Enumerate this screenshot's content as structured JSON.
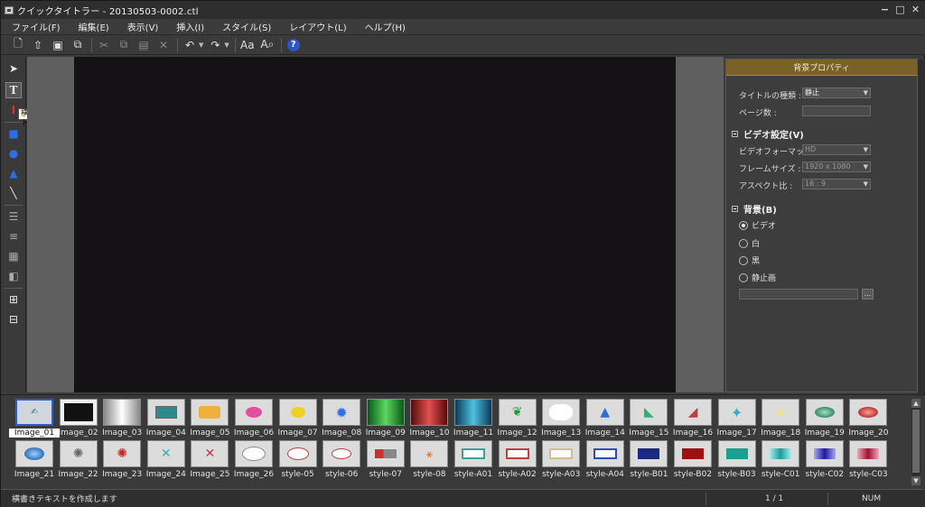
{
  "window": {
    "title": "クイックタイトラー - 20130503-0002.ctl",
    "controls": [
      "−",
      "□",
      "✕"
    ]
  },
  "menu": [
    "ファイル(F)",
    "編集(E)",
    "表示(V)",
    "挿入(I)",
    "スタイル(S)",
    "レイアウト(L)",
    "ヘルプ(H)"
  ],
  "toolbar": {
    "icons": [
      "new-icon",
      "open-icon",
      "save-icon",
      "save-as-icon",
      "cut-icon",
      "copy-icon",
      "paste-icon",
      "delete-icon",
      "undo-icon",
      "redo-icon",
      "text-style-icon",
      "text-search-icon",
      "help-icon"
    ],
    "help_label": "?"
  },
  "tools": [
    "select-arrow-icon",
    "horizontal-text-icon",
    "vertical-text-icon",
    "rectangle-icon",
    "ellipse-icon",
    "triangle-icon",
    "line-icon",
    "align-icon",
    "distribute-icon",
    "layer-icon",
    "arrange-icon",
    "grid-icon",
    "table-icon"
  ],
  "tooltip": "横書きテキスト",
  "properties": {
    "header": "背景プロパティ",
    "title_type_label": "タイトルの種類 :",
    "title_type_value": "静止",
    "page_count_label": "ページ数 :",
    "page_count_value": "",
    "video_section": "ビデオ設定(V)",
    "video_format_label": "ビデオフォーマット :",
    "video_format_value": "HD",
    "frame_size_label": "フレームサイズ :",
    "frame_size_value": "1920 x 1080",
    "aspect_label": "アスペクト比 :",
    "aspect_value": "16 : 9",
    "bg_section": "背景(B)",
    "bg_options": [
      "ビデオ",
      "白",
      "黒",
      "静止画"
    ],
    "bg_selected": "ビデオ",
    "browse_label": "..."
  },
  "gallery": {
    "row1": [
      "Image_01",
      "Image_02",
      "Image_03",
      "Image_04",
      "Image_05",
      "Image_06",
      "Image_07",
      "Image_08",
      "Image_09",
      "Image_10",
      "Image_11",
      "Image_12",
      "Image_13",
      "Image_14",
      "Image_15",
      "Image_16",
      "Image_17",
      "Image_18",
      "Image_19",
      "Image_20"
    ],
    "row2": [
      "Image_21",
      "Image_22",
      "Image_23",
      "Image_24",
      "Image_25",
      "Image_26",
      "style-05",
      "style-06",
      "style-07",
      "style-08",
      "style-A01",
      "style-A02",
      "style-A03",
      "style-A04",
      "style-B01",
      "style-B02",
      "style-B03",
      "style-C01",
      "style-C02",
      "style-C03"
    ],
    "selected": "Image_01"
  },
  "status": {
    "message": "横書きテキストを作成します",
    "page": "1 / 1",
    "num": "NUM"
  }
}
